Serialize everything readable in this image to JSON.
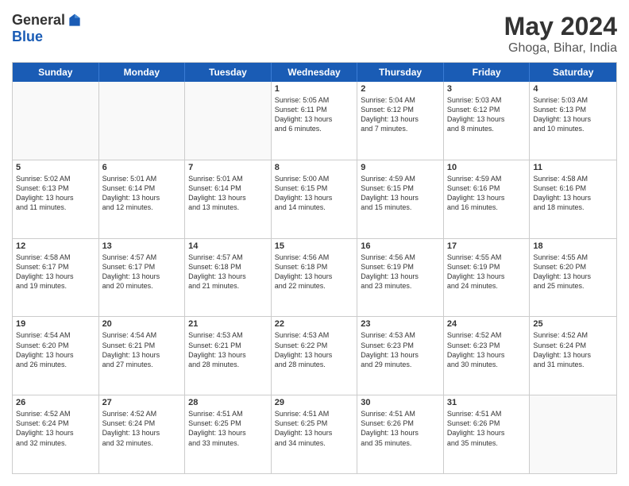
{
  "logo": {
    "general": "General",
    "blue": "Blue"
  },
  "title": "May 2024",
  "location": "Ghoga, Bihar, India",
  "weekdays": [
    "Sunday",
    "Monday",
    "Tuesday",
    "Wednesday",
    "Thursday",
    "Friday",
    "Saturday"
  ],
  "weeks": [
    [
      {
        "day": "",
        "text": "",
        "empty": true
      },
      {
        "day": "",
        "text": "",
        "empty": true
      },
      {
        "day": "",
        "text": "",
        "empty": true
      },
      {
        "day": "1",
        "text": "Sunrise: 5:05 AM\nSunset: 6:11 PM\nDaylight: 13 hours\nand 6 minutes."
      },
      {
        "day": "2",
        "text": "Sunrise: 5:04 AM\nSunset: 6:12 PM\nDaylight: 13 hours\nand 7 minutes."
      },
      {
        "day": "3",
        "text": "Sunrise: 5:03 AM\nSunset: 6:12 PM\nDaylight: 13 hours\nand 8 minutes."
      },
      {
        "day": "4",
        "text": "Sunrise: 5:03 AM\nSunset: 6:13 PM\nDaylight: 13 hours\nand 10 minutes."
      }
    ],
    [
      {
        "day": "5",
        "text": "Sunrise: 5:02 AM\nSunset: 6:13 PM\nDaylight: 13 hours\nand 11 minutes."
      },
      {
        "day": "6",
        "text": "Sunrise: 5:01 AM\nSunset: 6:14 PM\nDaylight: 13 hours\nand 12 minutes."
      },
      {
        "day": "7",
        "text": "Sunrise: 5:01 AM\nSunset: 6:14 PM\nDaylight: 13 hours\nand 13 minutes."
      },
      {
        "day": "8",
        "text": "Sunrise: 5:00 AM\nSunset: 6:15 PM\nDaylight: 13 hours\nand 14 minutes."
      },
      {
        "day": "9",
        "text": "Sunrise: 4:59 AM\nSunset: 6:15 PM\nDaylight: 13 hours\nand 15 minutes."
      },
      {
        "day": "10",
        "text": "Sunrise: 4:59 AM\nSunset: 6:16 PM\nDaylight: 13 hours\nand 16 minutes."
      },
      {
        "day": "11",
        "text": "Sunrise: 4:58 AM\nSunset: 6:16 PM\nDaylight: 13 hours\nand 18 minutes."
      }
    ],
    [
      {
        "day": "12",
        "text": "Sunrise: 4:58 AM\nSunset: 6:17 PM\nDaylight: 13 hours\nand 19 minutes."
      },
      {
        "day": "13",
        "text": "Sunrise: 4:57 AM\nSunset: 6:17 PM\nDaylight: 13 hours\nand 20 minutes."
      },
      {
        "day": "14",
        "text": "Sunrise: 4:57 AM\nSunset: 6:18 PM\nDaylight: 13 hours\nand 21 minutes."
      },
      {
        "day": "15",
        "text": "Sunrise: 4:56 AM\nSunset: 6:18 PM\nDaylight: 13 hours\nand 22 minutes."
      },
      {
        "day": "16",
        "text": "Sunrise: 4:56 AM\nSunset: 6:19 PM\nDaylight: 13 hours\nand 23 minutes."
      },
      {
        "day": "17",
        "text": "Sunrise: 4:55 AM\nSunset: 6:19 PM\nDaylight: 13 hours\nand 24 minutes."
      },
      {
        "day": "18",
        "text": "Sunrise: 4:55 AM\nSunset: 6:20 PM\nDaylight: 13 hours\nand 25 minutes."
      }
    ],
    [
      {
        "day": "19",
        "text": "Sunrise: 4:54 AM\nSunset: 6:20 PM\nDaylight: 13 hours\nand 26 minutes."
      },
      {
        "day": "20",
        "text": "Sunrise: 4:54 AM\nSunset: 6:21 PM\nDaylight: 13 hours\nand 27 minutes."
      },
      {
        "day": "21",
        "text": "Sunrise: 4:53 AM\nSunset: 6:21 PM\nDaylight: 13 hours\nand 28 minutes."
      },
      {
        "day": "22",
        "text": "Sunrise: 4:53 AM\nSunset: 6:22 PM\nDaylight: 13 hours\nand 28 minutes."
      },
      {
        "day": "23",
        "text": "Sunrise: 4:53 AM\nSunset: 6:23 PM\nDaylight: 13 hours\nand 29 minutes."
      },
      {
        "day": "24",
        "text": "Sunrise: 4:52 AM\nSunset: 6:23 PM\nDaylight: 13 hours\nand 30 minutes."
      },
      {
        "day": "25",
        "text": "Sunrise: 4:52 AM\nSunset: 6:24 PM\nDaylight: 13 hours\nand 31 minutes."
      }
    ],
    [
      {
        "day": "26",
        "text": "Sunrise: 4:52 AM\nSunset: 6:24 PM\nDaylight: 13 hours\nand 32 minutes."
      },
      {
        "day": "27",
        "text": "Sunrise: 4:52 AM\nSunset: 6:24 PM\nDaylight: 13 hours\nand 32 minutes."
      },
      {
        "day": "28",
        "text": "Sunrise: 4:51 AM\nSunset: 6:25 PM\nDaylight: 13 hours\nand 33 minutes."
      },
      {
        "day": "29",
        "text": "Sunrise: 4:51 AM\nSunset: 6:25 PM\nDaylight: 13 hours\nand 34 minutes."
      },
      {
        "day": "30",
        "text": "Sunrise: 4:51 AM\nSunset: 6:26 PM\nDaylight: 13 hours\nand 35 minutes."
      },
      {
        "day": "31",
        "text": "Sunrise: 4:51 AM\nSunset: 6:26 PM\nDaylight: 13 hours\nand 35 minutes."
      },
      {
        "day": "",
        "text": "",
        "empty": true
      }
    ]
  ]
}
